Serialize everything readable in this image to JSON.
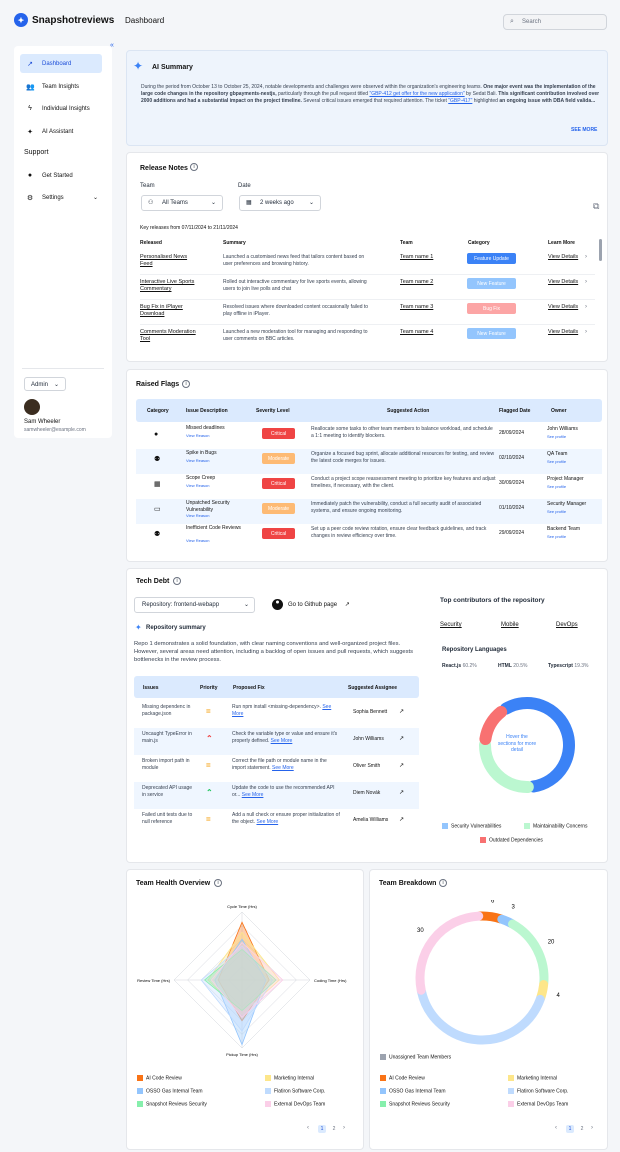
{
  "app": {
    "logo_text": "Snapshotreviews",
    "page_title": "Dashboard",
    "search_placeholder": "Search"
  },
  "sidebar": {
    "items": [
      "Dashboard",
      "Team Insights",
      "Individual Insights",
      "AI Assistant"
    ],
    "support_heading": "Support",
    "support_items": [
      "Get Started",
      "Settings"
    ],
    "role": "Admin",
    "user_name": "Sam Wheeler",
    "user_email": "samwheeler@example.com"
  },
  "ai_summary": {
    "title": "AI Summary",
    "p1": "During the period from October 13 to October 25, 2024, notable developments and challenges were observed within the organization's engineering teams. ",
    "b1": "One major event was the implementation of the large code changes in the repository gbpayments-nestjs,",
    "p2": " particularly through the pull request titled ",
    "l1": "\"GBP-412 get offer for the new application\"",
    "p3": " by Sedat Bali. ",
    "b2": "This significant contribution involved over 2000 additions and had a substantial impact on the project timeline.",
    "p4": " Several critical issues emerged that required attention. The ticket ",
    "l2": "\"GBP-417\"",
    "p5": " highlighted ",
    "b3": "an ongoing issue with DBA field valida...",
    "see_more": "SEE MORE"
  },
  "release_notes": {
    "title": "Release Notes",
    "team_label": "Team",
    "team_value": "All Teams",
    "date_label": "Date",
    "date_value": "2 weeks ago",
    "range": "Key releases from 07/11/2024 to 21/11/2024",
    "cols": [
      "Released",
      "Summary",
      "Team",
      "Category",
      "Learn More"
    ],
    "rows": [
      {
        "released": "Personalised News Feed",
        "summary": "Launched a customised news feed that tailors content based on user preferences and browsing history.",
        "team": "Team name 1",
        "category": "Feature Update",
        "learn": "View Details"
      },
      {
        "released": "Interactive Live Sports Commentary",
        "summary": "Rolled out interactive commentary for live sports events, allowing users to join live polls and chat",
        "team": "Team name 2",
        "category": "New Feature",
        "learn": "View Details"
      },
      {
        "released": "Bug Fix in iPlayer Download",
        "summary": "Resolved issues where downloaded content occasionally failed to play offline in iPlayer.",
        "team": "Team name 3",
        "category": "Bug Fix",
        "learn": "View Details"
      },
      {
        "released": "Comments Moderation Tool",
        "summary": "Launched a new moderation tool for managing and responding to user comments on BBC articles.",
        "team": "Team name 4",
        "category": "New Feature",
        "learn": "View Details"
      }
    ]
  },
  "raised_flags": {
    "title": "Raised Flags",
    "cols": [
      "Category",
      "Issue Description",
      "Severity Level",
      "Suggested Action",
      "Flagged Date",
      "Owner"
    ],
    "view_reason": "View Reason",
    "see_profile": "See profile",
    "rows": [
      {
        "issue": "Missed deadlines",
        "severity": "Critical",
        "action": "Reallocate some tasks to other team members to balance workload, and schedule a 1:1 meeting to identify blockers.",
        "date": "28/09/2024",
        "owner": "John Williams"
      },
      {
        "issue": "Spike in Bugs",
        "severity": "Moderate",
        "action": "Organize a focused bug sprint, allocate additional resources for testing, and review the latest code merges for issues.",
        "date": "02/10/2024",
        "owner": "QA Team"
      },
      {
        "issue": "Scope Creep",
        "severity": "Critical",
        "action": "Conduct a project scope reassessment meeting to prioritize key features and adjust timelines, if necessary, with the client.",
        "date": "30/09/2024",
        "owner": "Project Manager"
      },
      {
        "issue": "Unpatched Security Vulnerability",
        "severity": "Moderate",
        "action": "Immediately patch the vulnerability, conduct a full security audit of associated systems, and ensure ongoing monitoring.",
        "date": "01/10/2024",
        "owner": "Security Manager"
      },
      {
        "issue": "Inefficient Code Reviews",
        "severity": "Critical",
        "action": "Set up a peer code review rotation, ensure clear feedback guidelines, and track changes in review efficiency over time.",
        "date": "29/09/2024",
        "owner": "Backend Team"
      }
    ]
  },
  "tech_debt": {
    "title": "Tech Debt",
    "repo_label": "Repository:",
    "repo_value": "frontend-webapp",
    "github": "Go to Github page",
    "summary_title": "Repository summary",
    "summary": "Repo 1 demonstrates a solid foundation, with clear naming conventions and well-organized project files. However, several areas need attention, including a backlog of open issues and pull requests, which suggests bottlenecks in the review process.",
    "cols": [
      "Issues",
      "Priority",
      "Proposed Fix",
      "Suggested Assignee"
    ],
    "see_more": "See More",
    "rows": [
      {
        "issue": "Missing dependenc in package.json",
        "fix": "Run npm install <missing-dependency>.",
        "assignee": "Sophia Bennett"
      },
      {
        "issue": "Uncaught TypeError in main.js",
        "fix": "Check the variable type or value and ensure it's properly defined.",
        "assignee": "John Williams"
      },
      {
        "issue": "Broken import path in module",
        "fix": "Correct the file path or module name in the import statement.",
        "assignee": "Oliver Smith"
      },
      {
        "issue": "Deprecated API usage in service",
        "fix": "Update the code to use the recommended API or...",
        "assignee": "Diem Novák"
      },
      {
        "issue": "Failed unit tests due to null reference",
        "fix": "Add a null check or ensure proper initialization of the object.",
        "assignee": "Amelia Williams"
      }
    ],
    "contributors_title": "Top contributors of the repository",
    "contributors": [
      "Security",
      "Mobile",
      "DevOps"
    ],
    "languages_title": "Repository Languages",
    "languages": [
      {
        "name": "React.js",
        "pct": "60.2%"
      },
      {
        "name": "HTML",
        "pct": "20.5%"
      },
      {
        "name": "Typescript",
        "pct": "19.3%"
      }
    ],
    "donut_hint": "Hover the sections for more detail",
    "legend": [
      "Security Vulnerabilities",
      "Maintainability Concerns",
      "Outdated Dependencies"
    ],
    "donut": [
      {
        "value": 55,
        "color": "#3b82f6"
      },
      {
        "value": 25,
        "color": "#bbf7d0"
      },
      {
        "value": 12,
        "color": "#f87171"
      }
    ]
  },
  "team_health": {
    "title": "Team Health Overview",
    "axes": [
      "Cycle Time (Hrs)",
      "Coding Time (Hrs)",
      "Pickup Time (Hrs)",
      "Review Time (Hrs)"
    ],
    "legend": [
      "AI Code Review",
      "Marketing Internal",
      "OSSO Gas Internal Team",
      "Flatiron Software Corp.",
      "Snapshot Reviews Security",
      "External DevOps Team"
    ],
    "series": [
      {
        "color": "#f97316",
        "values": [
          0.85,
          0.4,
          0.6,
          0.35
        ]
      },
      {
        "color": "#fde68a",
        "values": [
          0.7,
          0.55,
          0.5,
          0.5
        ]
      },
      {
        "color": "#93c5fd",
        "values": [
          0.6,
          0.35,
          0.95,
          0.4
        ]
      },
      {
        "color": "#bfdbfe",
        "values": [
          0.5,
          0.45,
          0.75,
          0.6
        ]
      },
      {
        "color": "#86efac",
        "values": [
          0.45,
          0.5,
          0.45,
          0.55
        ]
      },
      {
        "color": "#fbcfe8",
        "values": [
          0.55,
          0.6,
          0.55,
          0.45
        ]
      }
    ],
    "pages": [
      "1",
      "2"
    ]
  },
  "team_breakdown": {
    "title": "Team Breakdown",
    "unassigned": "Unassigned Team Members",
    "legend": [
      "AI Code Review",
      "Marketing Internal",
      "OSSO Gas Internal Team",
      "Flatiron Software Corp.",
      "Snapshot Reviews Security",
      "External DevOps Team"
    ],
    "values": [
      {
        "value": 6,
        "color": "#f97316"
      },
      {
        "value": 3,
        "color": "#93c5fd"
      },
      {
        "value": 20,
        "color": "#bbf7d0"
      },
      {
        "value": 4,
        "color": "#fde68a"
      },
      {
        "value": 45,
        "color": "#bfdbfe"
      },
      {
        "value": 30,
        "color": "#fbcfe8"
      }
    ],
    "pages": [
      "1",
      "2"
    ]
  }
}
